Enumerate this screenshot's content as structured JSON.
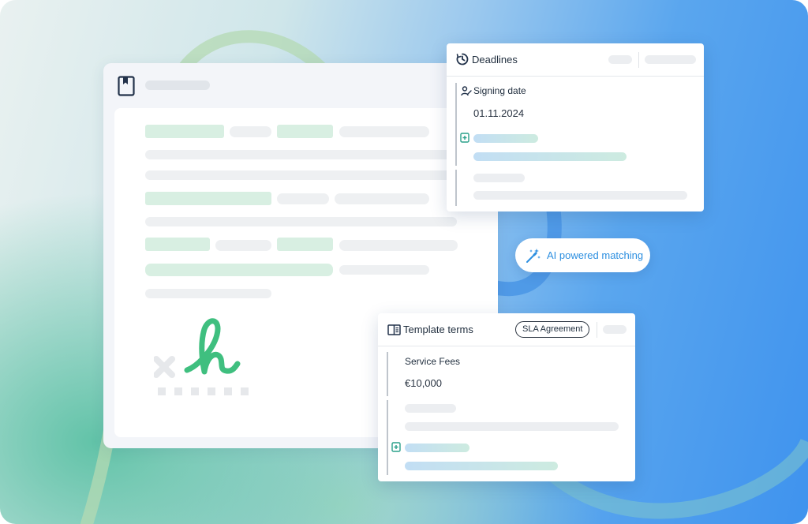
{
  "deadlines_card": {
    "title": "Deadlines",
    "field_label": "Signing date",
    "field_value": "01.11.2024"
  },
  "ai_badge": {
    "label": "AI powered matching"
  },
  "terms_card": {
    "title": "Template terms",
    "tag": "SLA Agreement",
    "field_label": "Service Fees",
    "field_value": "€10,000"
  },
  "icons": {
    "document": "bookmark-document-icon",
    "deadlines": "clock-icon",
    "signing": "user-signature-icon",
    "add": "add-box-icon",
    "ai": "magic-wand-icon",
    "terms": "book-open-icon"
  },
  "colors": {
    "accent_blue": "#2d8fe0",
    "signature_green": "#3fbf7f",
    "skeleton_green": "#d8efe2",
    "skeleton_gray": "#eceef1"
  }
}
